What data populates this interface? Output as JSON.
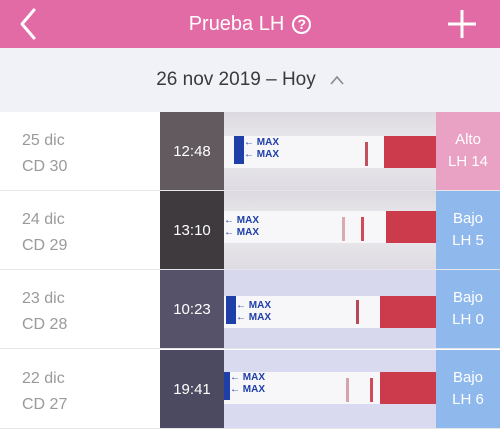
{
  "header": {
    "title": "Prueba LH",
    "help_glyph": "?",
    "color": "#e26ba5"
  },
  "datebar": {
    "range": "26 nov 2019 – Hoy"
  },
  "strip_labels": {
    "max_top": "← MAX",
    "max_bottom": "← MAX"
  },
  "rows": [
    {
      "date": "25 dic",
      "cd": "CD 30",
      "time": "12:48",
      "result": "Alto",
      "lh": "LH 14",
      "result_color": "#e9a2c3"
    },
    {
      "date": "24 dic",
      "cd": "CD 29",
      "time": "13:10",
      "result": "Bajo",
      "lh": "LH 5",
      "result_color": "#8fb8ec"
    },
    {
      "date": "23 dic",
      "cd": "CD 28",
      "time": "10:23",
      "result": "Bajo",
      "lh": "LH 0",
      "result_color": "#8fb8ec"
    },
    {
      "date": "22 dic",
      "cd": "CD 27",
      "time": "19:41",
      "result": "Bajo",
      "lh": "LH 6",
      "result_color": "#8fb8ec"
    }
  ]
}
